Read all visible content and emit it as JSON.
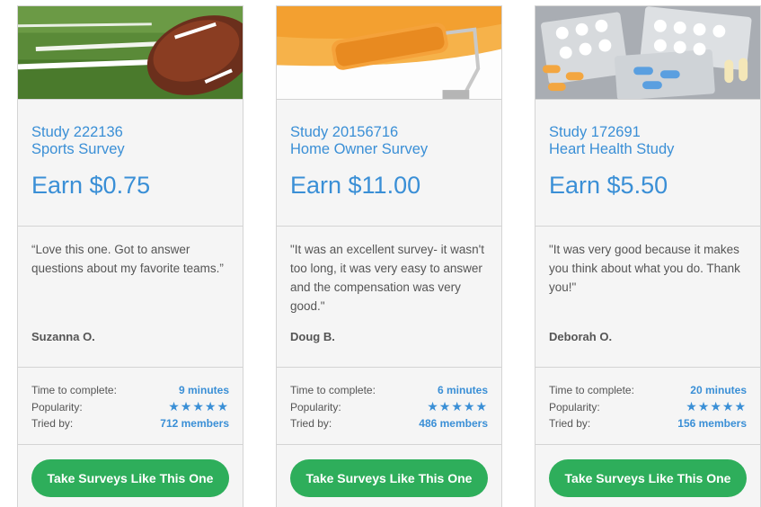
{
  "cards": [
    {
      "image_icon": "football-image",
      "study_id": "Study 222136",
      "study_name": "Sports Survey",
      "earn": "Earn $0.75",
      "quote": "“Love this one. Got to answer questions about my favorite teams.”",
      "author": "Suzanna O.",
      "stats": {
        "time_label": "Time to complete:",
        "time_value": "9 minutes",
        "popularity_label": "Popularity:",
        "popularity_stars": "★★★★★",
        "popularity_rating": 5,
        "tried_label": "Tried by:",
        "tried_value": "712 members"
      },
      "cta": "Take Surveys Like This One"
    },
    {
      "image_icon": "paint-roller-image",
      "study_id": "Study 20156716",
      "study_name": "Home Owner Survey",
      "earn": "Earn $11.00",
      "quote": "\"It was an excellent survey- it wasn't too long, it was very easy to answer and the compensation was very good.\"",
      "author": "Doug B.",
      "stats": {
        "time_label": "Time to complete:",
        "time_value": "6 minutes",
        "popularity_label": "Popularity:",
        "popularity_stars": "★★★★★",
        "popularity_rating": 5,
        "tried_label": "Tried by:",
        "tried_value": "486 members"
      },
      "cta": "Take Surveys Like This One"
    },
    {
      "image_icon": "pills-image",
      "study_id": "Study 172691",
      "study_name": "Heart Health Study",
      "earn": "Earn $5.50",
      "quote": "\"It was very good because it makes you think about what you do. Thank you!\"",
      "author": "Deborah O.",
      "stats": {
        "time_label": "Time to complete:",
        "time_value": "20 minutes",
        "popularity_label": "Popularity:",
        "popularity_stars": "★★★★★",
        "popularity_rating": 5,
        "tried_label": "Tried by:",
        "tried_value": "156 members"
      },
      "cta": "Take Surveys Like This One"
    }
  ],
  "colors": {
    "accent_blue": "#3a8fd6",
    "cta_green": "#2eae5b",
    "card_bg": "#f5f5f5",
    "border": "#d4d4d4",
    "text_gray": "#555555"
  }
}
